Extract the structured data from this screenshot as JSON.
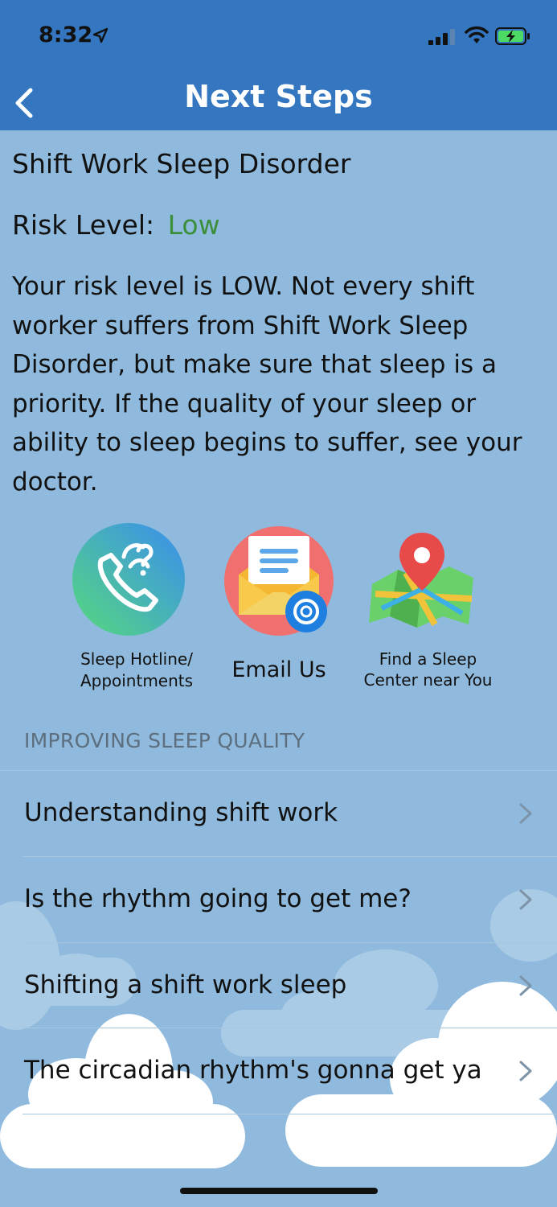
{
  "status_bar": {
    "time": "8:32"
  },
  "nav": {
    "title": "Next Steps",
    "back_icon": "chevron-left-icon"
  },
  "result": {
    "condition": "Shift Work Sleep Disorder",
    "risk_label": "Risk Level:",
    "risk_value": "Low",
    "risk_color": "#3b8f3a",
    "description": "Your risk level is LOW. Not every shift worker suffers from Shift Work Sleep Disorder, but make sure that sleep is a priority. If the quality of your sleep or ability to sleep begins to suffer, see your doctor."
  },
  "actions": [
    {
      "line1": "Sleep Hotline/",
      "line2": "Appointments",
      "icon": "phone-question-icon"
    },
    {
      "label": "Email Us",
      "icon": "envelope-at-icon"
    },
    {
      "line1": "Find a Sleep",
      "line2": "Center near You",
      "icon": "map-pin-icon"
    }
  ],
  "section": {
    "header": "IMPROVING SLEEP QUALITY",
    "items": [
      {
        "label": "Understanding shift work"
      },
      {
        "label": "Is the rhythm going to get me?"
      },
      {
        "label": "Shifting a shift work sleep"
      },
      {
        "label": "The circadian rhythm's gonna get ya"
      }
    ]
  },
  "colors": {
    "nav_bar": "#3476bf",
    "background": "#8fbadd",
    "text": "#111111"
  }
}
